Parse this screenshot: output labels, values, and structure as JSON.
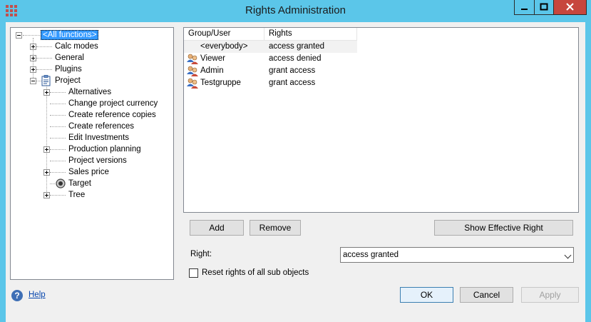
{
  "window": {
    "title": "Rights Administration"
  },
  "tree": {
    "root": "<All functions>",
    "items": [
      {
        "label": "Calc modes",
        "level": 1,
        "expandable": true
      },
      {
        "label": "General",
        "level": 1,
        "expandable": true
      },
      {
        "label": "Plugins",
        "level": 1,
        "expandable": true
      },
      {
        "label": "Project",
        "level": 1,
        "expandable": true,
        "expanded": true,
        "icon": "clipboard-icon"
      },
      {
        "label": "Alternatives",
        "level": 2,
        "expandable": true
      },
      {
        "label": "Change project currency",
        "level": 2,
        "expandable": false
      },
      {
        "label": "Create reference copies",
        "level": 2,
        "expandable": false
      },
      {
        "label": "Create references",
        "level": 2,
        "expandable": false
      },
      {
        "label": "Edit Investments",
        "level": 2,
        "expandable": false
      },
      {
        "label": "Production planning",
        "level": 2,
        "expandable": true
      },
      {
        "label": "Project versions",
        "level": 2,
        "expandable": false
      },
      {
        "label": "Sales price",
        "level": 2,
        "expandable": true
      },
      {
        "label": "Target",
        "level": 2,
        "expandable": false,
        "icon": "target-icon"
      },
      {
        "label": "Tree",
        "level": 2,
        "expandable": true
      }
    ]
  },
  "list": {
    "columns": [
      "Group/User",
      "Rights"
    ],
    "rows": [
      {
        "user": "<everybody>",
        "right": "access granted",
        "icon": false
      },
      {
        "user": "Viewer",
        "right": "access denied",
        "icon": true
      },
      {
        "user": "Admin",
        "right": "grant access",
        "icon": true
      },
      {
        "user": "Testgruppe",
        "right": "grant access",
        "icon": true
      }
    ]
  },
  "buttons": {
    "add": "Add",
    "remove": "Remove",
    "show_effective": "Show Effective Right",
    "ok": "OK",
    "cancel": "Cancel",
    "apply": "Apply"
  },
  "right_label": "Right:",
  "right_value": "access granted",
  "reset_label": "Reset rights of all sub objects",
  "help_label": "Help",
  "colors": {
    "titlebar": "#5bc6e9",
    "close": "#c7463d",
    "selection": "#3399ff"
  }
}
